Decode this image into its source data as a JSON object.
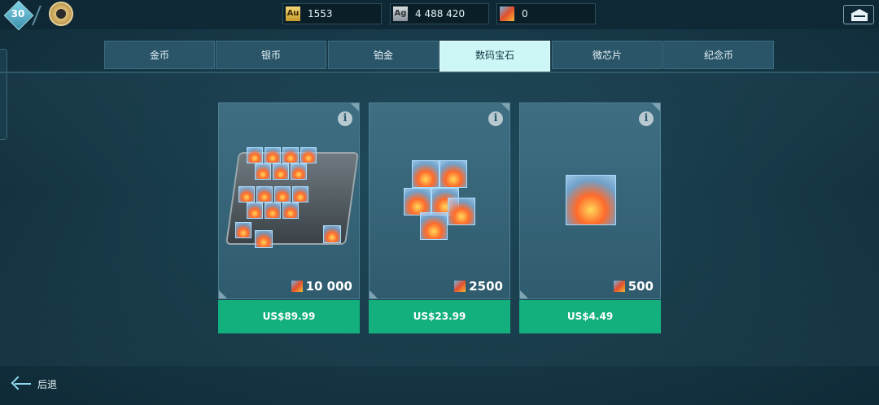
{
  "header": {
    "level": "30",
    "currencies": [
      {
        "icon": "Au",
        "value": "1553"
      },
      {
        "icon": "Ag",
        "value": "4 488 420"
      },
      {
        "icon": "digital-gem-icon",
        "value": "0"
      }
    ]
  },
  "tabs": [
    "金币",
    "银币",
    "铂金",
    "数码宝石",
    "微芯片",
    "纪念币"
  ],
  "active_tab": "数码宝石",
  "offers": [
    {
      "amount": "10 000",
      "price": "US$89.99"
    },
    {
      "amount": "2500",
      "price": "US$23.99"
    },
    {
      "amount": "500",
      "price": "US$4.49"
    }
  ],
  "info_glyph": "i",
  "footer": {
    "back_label": "后退"
  },
  "colors": {
    "accent_buy": "#13b07e",
    "tab_active": "#cdf6f6",
    "background": "#163746"
  }
}
